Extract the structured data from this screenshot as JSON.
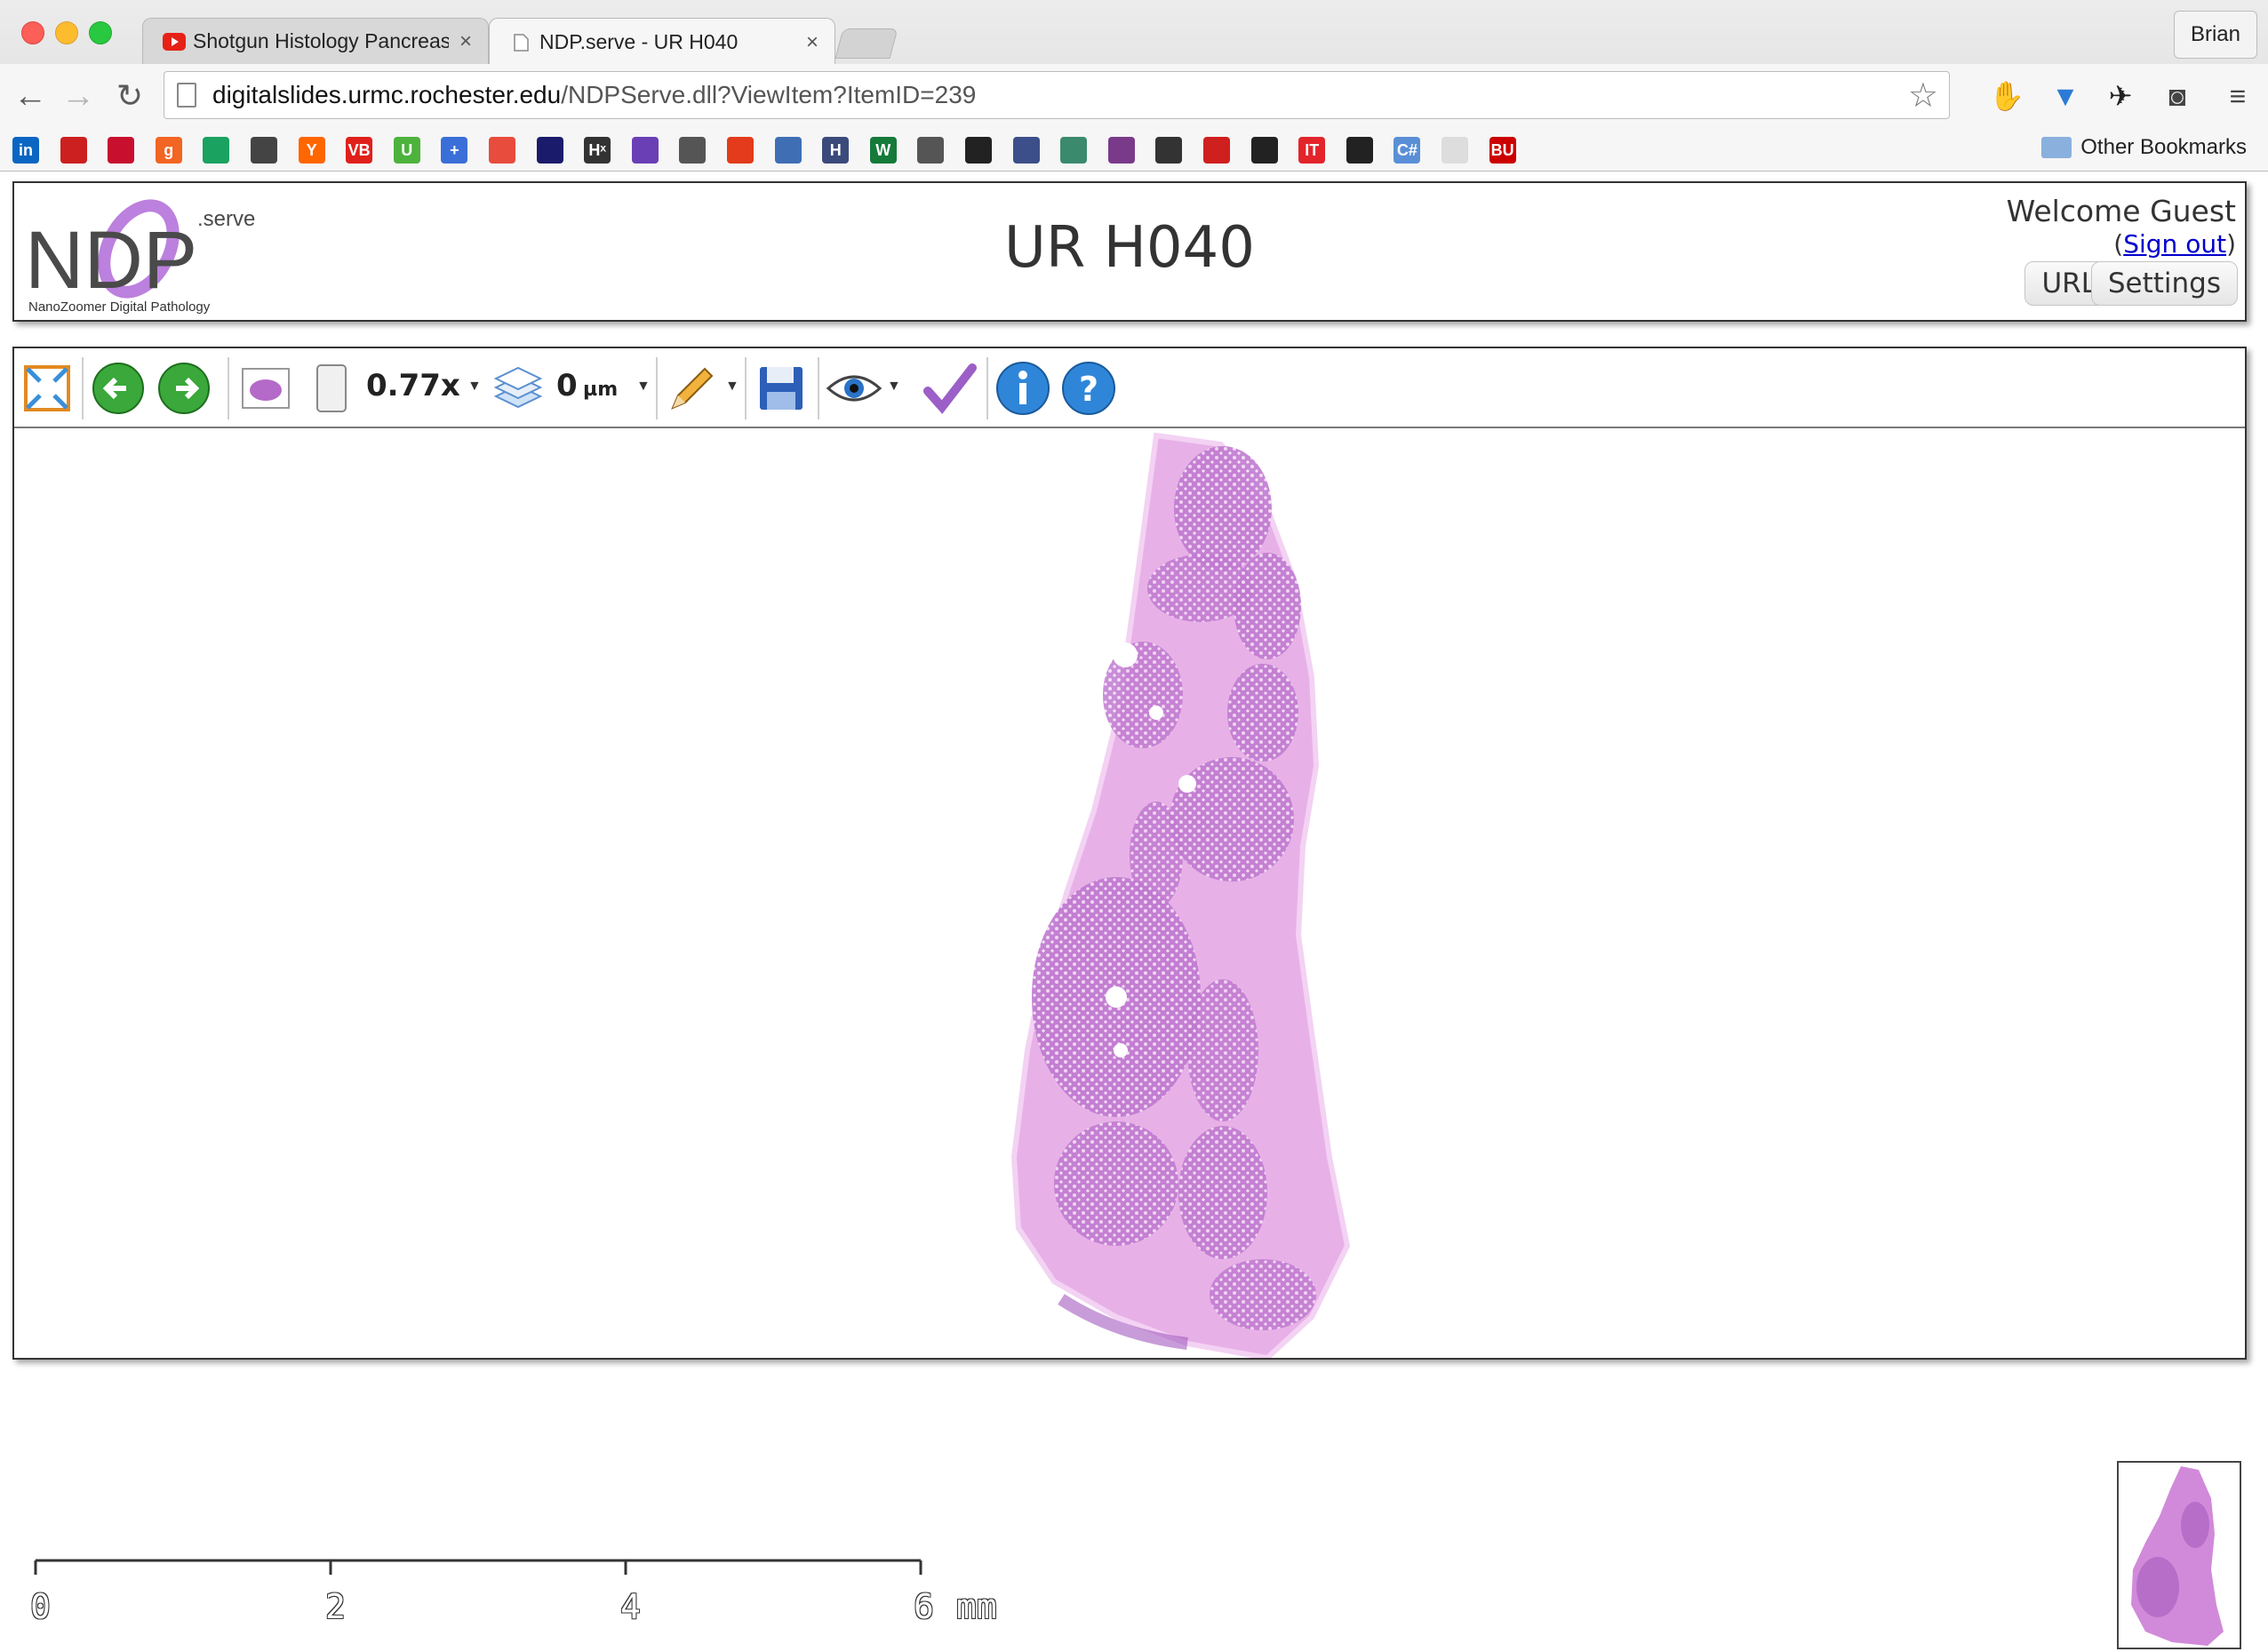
{
  "browser": {
    "tabs": [
      {
        "title": "Shotgun Histology Pancreas",
        "favicon": "youtube-icon"
      },
      {
        "title": "NDP.serve - UR H040",
        "favicon": "page-icon"
      }
    ],
    "profile": "Brian",
    "url_host": "digitalslides.urmc.rochester.edu",
    "url_path": "/NDPServe.dll?ViewItem?ItemID=239",
    "bookmarks": [
      {
        "icon": "linkedin-icon",
        "color": "#0a66c2",
        "text": "in"
      },
      {
        "icon": "bookmark-red-icon",
        "color": "#cc2020",
        "text": ""
      },
      {
        "icon": "bank-icon",
        "color": "#c8102e",
        "text": ""
      },
      {
        "icon": "g-icon",
        "color": "#f26522",
        "text": "g"
      },
      {
        "icon": "m-icon",
        "color": "#1aa260",
        "text": ""
      },
      {
        "icon": "news-icon",
        "color": "#444444",
        "text": ""
      },
      {
        "icon": "ycombinator-icon",
        "color": "#ff6600",
        "text": "Y"
      },
      {
        "icon": "vb-icon",
        "color": "#e0201b",
        "text": "VB"
      },
      {
        "icon": "u-icon",
        "color": "#4db33d",
        "text": "U"
      },
      {
        "icon": "plus-icon",
        "color": "#3b6fd8",
        "text": "+"
      },
      {
        "icon": "pinwheel-icon",
        "color": "#e84c3d",
        "text": ""
      },
      {
        "icon": "grid-icon",
        "color": "#1b1b6b",
        "text": ""
      },
      {
        "icon": "hx-icon",
        "color": "#333333",
        "text": "Hˣ"
      },
      {
        "icon": "dots-icon",
        "color": "#6a3fb5",
        "text": ""
      },
      {
        "icon": "appress-icon",
        "color": "#555555",
        "text": ""
      },
      {
        "icon": "tomato-icon",
        "color": "#e33b1b",
        "text": ""
      },
      {
        "icon": "database-icon",
        "color": "#3f6eb5",
        "text": ""
      },
      {
        "icon": "h-icon",
        "color": "#3a4a7a",
        "text": "H"
      },
      {
        "icon": "w-icon",
        "color": "#157a3a",
        "text": "W"
      },
      {
        "icon": "chain-icon",
        "color": "#555555",
        "text": ""
      },
      {
        "icon": "bowtie-icon",
        "color": "#222222",
        "text": ""
      },
      {
        "icon": "flower-icon",
        "color": "#3c4f8a",
        "text": ""
      },
      {
        "icon": "molecule-icon",
        "color": "#3b8a6e",
        "text": ""
      },
      {
        "icon": "feather-icon",
        "color": "#7a3a8a",
        "text": ""
      },
      {
        "icon": "lines-icon",
        "color": "#333333",
        "text": ""
      },
      {
        "icon": "bars-icon",
        "color": "#d01f1f",
        "text": ""
      },
      {
        "icon": "dark-icon",
        "color": "#222222",
        "text": ""
      },
      {
        "icon": "it-icon",
        "color": "#e3242b",
        "text": "IT"
      },
      {
        "icon": "github-icon",
        "color": "#222222",
        "text": ""
      },
      {
        "icon": "csharp-icon",
        "color": "#5a8fd6",
        "text": "C#"
      },
      {
        "icon": "blank-page-icon",
        "color": "#dddddd",
        "text": ""
      },
      {
        "icon": "bu-icon",
        "color": "#cc0000",
        "text": "BU"
      }
    ],
    "other_bookmarks": "Other Bookmarks"
  },
  "header": {
    "logo_text_main": "NDP",
    "logo_serve": ".serve",
    "logo_sub": "NanoZoomer Digital Pathology",
    "title": "UR H040",
    "welcome": "Welcome Guest",
    "signout": "Sign out",
    "url_button": "URL",
    "settings_button": "Settings"
  },
  "viewer": {
    "zoom": "0.77x",
    "focus_value": "0",
    "focus_unit": "µm",
    "scale_labels": [
      "0",
      "2",
      "4",
      "6"
    ],
    "scale_unit": "mm"
  },
  "colors": {
    "tissue_stroma": "#e6a8e6",
    "tissue_lobule": "#b66cc8",
    "logo_purple": "#b06ad8"
  }
}
